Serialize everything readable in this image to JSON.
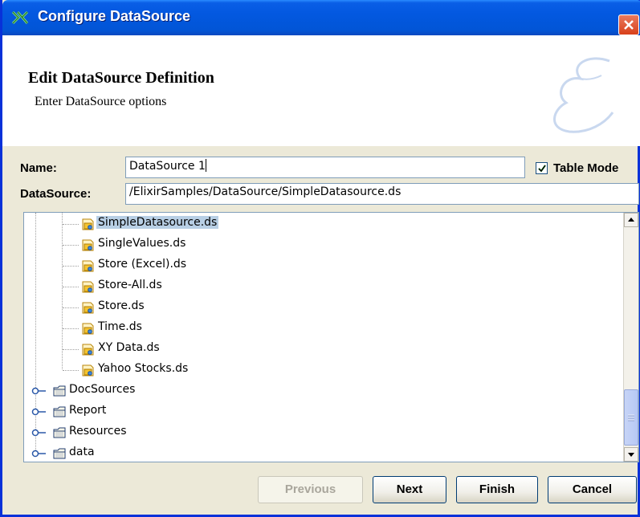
{
  "window": {
    "title": "Configure DataSource",
    "icon": "elixir-app-icon"
  },
  "header": {
    "title": "Edit DataSource Definition",
    "subtitle": "Enter DataSource options",
    "logo_letter": "E"
  },
  "form": {
    "name_label": "Name:",
    "name_value": "DataSource 1",
    "datasource_label": "DataSource:",
    "datasource_value": "/ElixirSamples/DataSource/SimpleDatasource.ds",
    "table_mode_label": "Table Mode",
    "table_mode_checked": true
  },
  "tree": {
    "files": [
      {
        "label": "SimpleDatasource.ds",
        "selected": true
      },
      {
        "label": "SingleValues.ds"
      },
      {
        "label": "Store (Excel).ds"
      },
      {
        "label": "Store-All.ds"
      },
      {
        "label": "Store.ds"
      },
      {
        "label": "Time.ds"
      },
      {
        "label": "XY Data.ds"
      },
      {
        "label": "Yahoo Stocks.ds"
      }
    ],
    "folders": [
      {
        "label": "DocSources"
      },
      {
        "label": "Report"
      },
      {
        "label": "Resources"
      },
      {
        "label": "data"
      }
    ]
  },
  "buttons": {
    "previous": "Previous",
    "next": "Next",
    "finish": "Finish",
    "cancel": "Cancel"
  },
  "colors": {
    "titlebar": "#0358e0",
    "selection": "#b8cfe5",
    "face": "#ece9d8"
  }
}
